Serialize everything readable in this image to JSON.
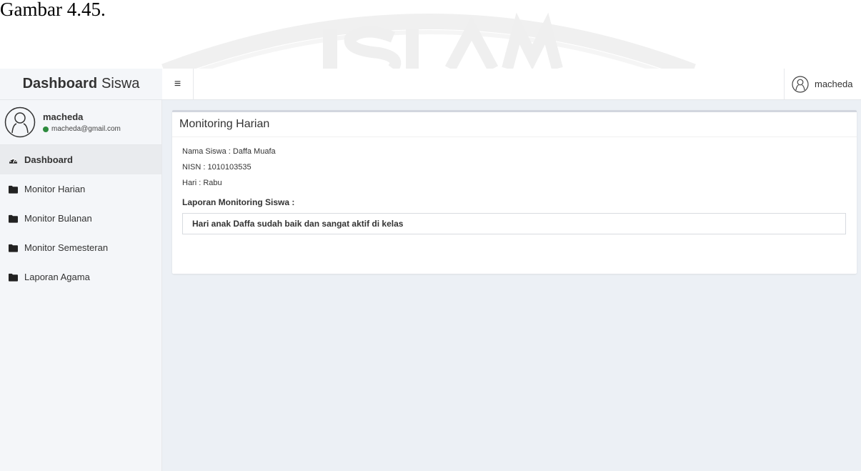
{
  "caption": "Gambar 4.45.",
  "brand": {
    "bold": "Dashboard",
    "rest": "Siswa"
  },
  "sidebar": {
    "user": {
      "name": "macheda",
      "email": "macheda@gmail.com"
    },
    "items": [
      {
        "label": "Dashboard",
        "icon": "dashboard-icon",
        "active": true
      },
      {
        "label": "Monitor Harian",
        "icon": "folder-icon"
      },
      {
        "label": "Monitor Bulanan",
        "icon": "folder-icon"
      },
      {
        "label": "Monitor Semesteran",
        "icon": "folder-icon"
      },
      {
        "label": "Laporan Agama",
        "icon": "folder-icon"
      }
    ]
  },
  "topbar": {
    "menu_icon": "≡",
    "username": "macheda"
  },
  "main": {
    "title": "Monitoring Harian",
    "nama": "Nama Siswa : Daffa Muafa",
    "nisn": "NISN : 1010103535",
    "hari": "Hari : Rabu",
    "report_label": "Laporan Monitoring Siswa :",
    "report_text": "Hari anak Daffa sudah baik dan sangat aktif di kelas"
  },
  "colors": {
    "status_online": "#2e8b3e",
    "content_bg": "#ecf0f5",
    "sidebar_bg": "#f4f6f9"
  }
}
